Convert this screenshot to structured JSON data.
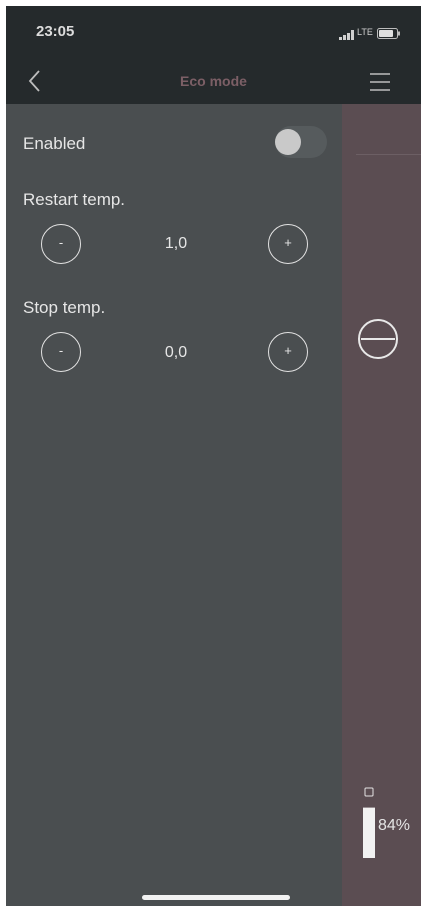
{
  "status_bar": {
    "time": "23:05",
    "carrier": "LTE",
    "signal_icon": "signal-bars-icon",
    "battery_icon": "battery-icon"
  },
  "nav": {
    "title": "Eco mode",
    "back_icon": "chevron-left-icon",
    "menu_icon": "hamburger-menu-icon",
    "title_color": "#7c5f66"
  },
  "settings": {
    "enabled_label": "Enabled",
    "enabled_value": false,
    "restart": {
      "label": "Restart temp.",
      "minus": "-",
      "plus": "+",
      "value": "1,0"
    },
    "stop": {
      "label": "Stop temp.",
      "minus": "-",
      "plus": "+",
      "value": "0,0"
    }
  },
  "side_panel": {
    "mode_icon": "minus-circle-icon",
    "battery_percent": "84%",
    "battery_level": 0.84,
    "panel_color": "#5b4d52"
  }
}
